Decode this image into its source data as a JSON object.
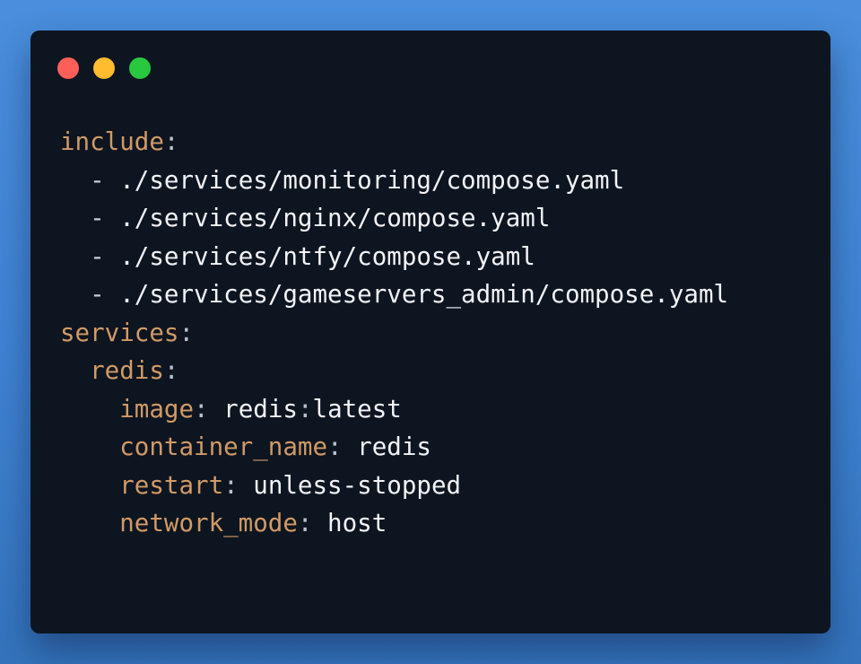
{
  "window": {
    "controls": [
      "close",
      "minimize",
      "maximize"
    ],
    "colors": {
      "close": "#ff5f57",
      "minimize": "#febc2e",
      "maximize": "#28c840",
      "background": "#0d1520",
      "key": "#d19a66",
      "value": "#f2f4f7"
    }
  },
  "code": {
    "include_key": "include",
    "include_items": [
      "./services/monitoring/compose.yaml",
      "./services/nginx/compose.yaml",
      "./services/ntfy/compose.yaml",
      "./services/gameservers_admin/compose.yaml"
    ],
    "services_key": "services",
    "service_name": "redis",
    "properties": [
      {
        "key": "image",
        "value_parts": [
          "redis",
          ":",
          "latest"
        ]
      },
      {
        "key": "container_name",
        "value": "redis"
      },
      {
        "key": "restart",
        "value": "unless-stopped"
      },
      {
        "key": "network_mode",
        "value": "host"
      }
    ]
  }
}
